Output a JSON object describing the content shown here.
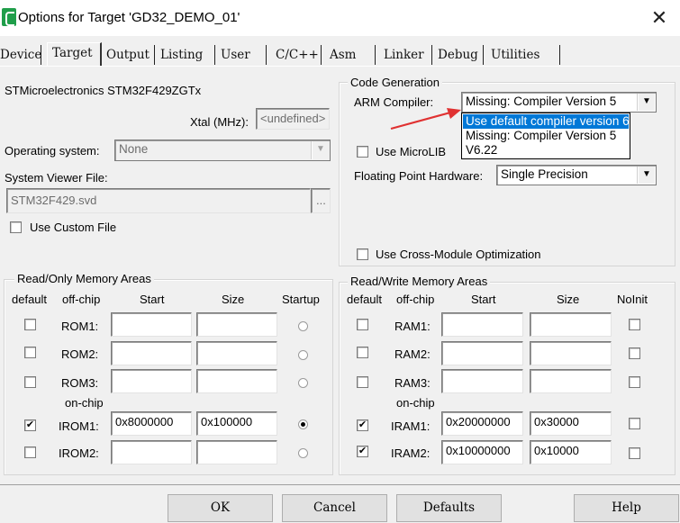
{
  "window": {
    "title": "Options for Target 'GD32_DEMO_01'",
    "close": "✕"
  },
  "tabs": [
    "Device",
    "Target",
    "Output",
    "Listing",
    "User",
    "C/C++",
    "Asm",
    "Linker",
    "Debug",
    "Utilities"
  ],
  "target": {
    "device": "STMicroelectronics STM32F429ZGTx",
    "xtal_label": "Xtal (MHz):",
    "xtal_value": "<undefined>",
    "os_label": "Operating system:",
    "os_value": "None",
    "svf_label": "System Viewer File:",
    "svf_value": "STM32F429.svd",
    "svf_browse": "...",
    "custom_file": "Use Custom File"
  },
  "codegen": {
    "title": "Code Generation",
    "compiler_label": "ARM Compiler:",
    "compiler_value": "Missing: Compiler Version 5",
    "options": [
      "Use default compiler version 6",
      "Missing: Compiler Version 5",
      "V6.22"
    ],
    "microlib": "Use MicroLIB",
    "fp_label": "Floating Point Hardware:",
    "fp_value": "Single Precision",
    "cross_module": "Use Cross-Module Optimization"
  },
  "ro": {
    "title": "Read/Only Memory Areas",
    "headers": [
      "default",
      "off-chip",
      "Start",
      "Size",
      "Startup"
    ],
    "offchip_rows": [
      {
        "name": "ROM1:",
        "start": "",
        "size": ""
      },
      {
        "name": "ROM2:",
        "start": "",
        "size": ""
      },
      {
        "name": "ROM3:",
        "start": "",
        "size": ""
      }
    ],
    "onchip_label": "on-chip",
    "onchip_rows": [
      {
        "name": "IROM1:",
        "start": "0x8000000",
        "size": "0x100000"
      },
      {
        "name": "IROM2:",
        "start": "",
        "size": ""
      }
    ]
  },
  "rw": {
    "title": "Read/Write Memory Areas",
    "headers": [
      "default",
      "off-chip",
      "Start",
      "Size",
      "NoInit"
    ],
    "offchip_rows": [
      {
        "name": "RAM1:",
        "start": "",
        "size": ""
      },
      {
        "name": "RAM2:",
        "start": "",
        "size": ""
      },
      {
        "name": "RAM3:",
        "start": "",
        "size": ""
      }
    ],
    "onchip_label": "on-chip",
    "onchip_rows": [
      {
        "name": "IRAM1:",
        "start": "0x20000000",
        "size": "0x30000"
      },
      {
        "name": "IRAM2:",
        "start": "0x10000000",
        "size": "0x10000"
      }
    ]
  },
  "buttons": {
    "ok": "OK",
    "cancel": "Cancel",
    "defaults": "Defaults",
    "help": "Help"
  },
  "colors": {
    "highlight": "#0078d7",
    "arrow": "#e03131",
    "app_icon": "#1f9e4a"
  }
}
